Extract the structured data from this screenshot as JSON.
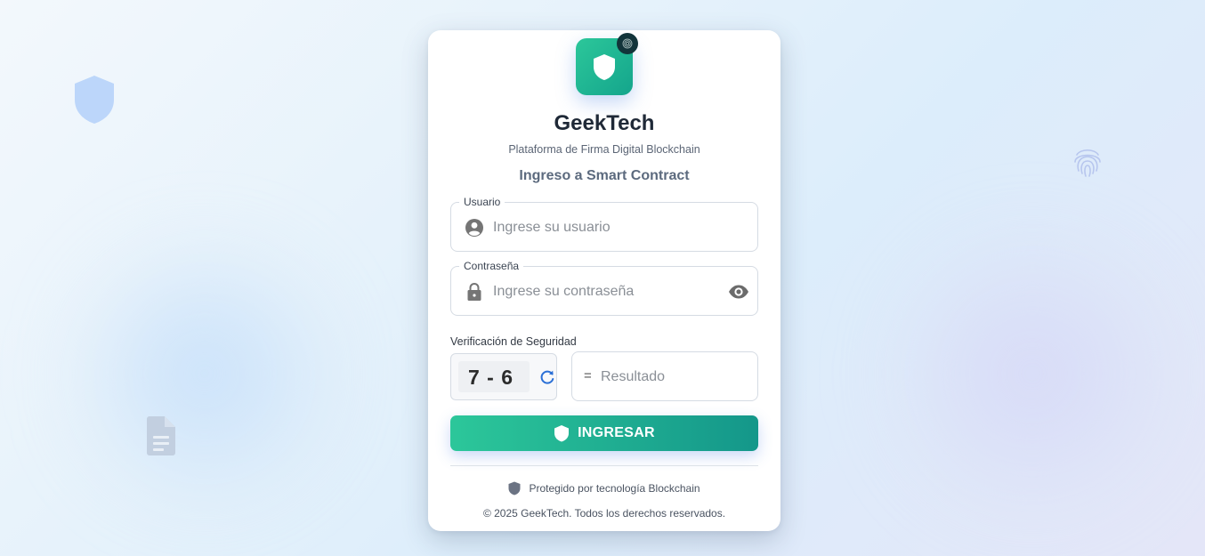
{
  "icons": {
    "bg_left_top": "shield-icon",
    "bg_left_bottom": "document-icon",
    "bg_right": "fingerprint-icon",
    "logo": "shield-icon",
    "logo_badge": "fingerprint-icon",
    "user_field": "user-circle-icon",
    "password_field": "lock-icon",
    "toggle_password": "eye-icon",
    "captcha_refresh": "refresh-icon",
    "submit": "shield-icon",
    "footer": "shield-icon"
  },
  "colors": {
    "accent_start": "#2cc79a",
    "accent_end": "#14978a",
    "badge": "#12343a",
    "refresh": "#2a6fd6"
  },
  "brand": {
    "name": "GeekTech",
    "subtitle": "Plataforma de Firma Digital Blockchain"
  },
  "form": {
    "title": "Ingreso a Smart Contract",
    "username": {
      "label": "Usuario",
      "placeholder": "Ingrese su usuario",
      "value": ""
    },
    "password": {
      "label": "Contraseña",
      "placeholder": "Ingrese su contraseña",
      "value": ""
    },
    "verification": {
      "label": "Verificación de Seguridad",
      "challenge": "7 - 6",
      "equals_sign": "=",
      "result_placeholder": "Resultado",
      "result_value": ""
    },
    "submit_label": "INGRESAR"
  },
  "footer": {
    "protected_text": "Protegido por tecnología Blockchain",
    "copyright": "© 2025 GeekTech. Todos los derechos reservados."
  }
}
